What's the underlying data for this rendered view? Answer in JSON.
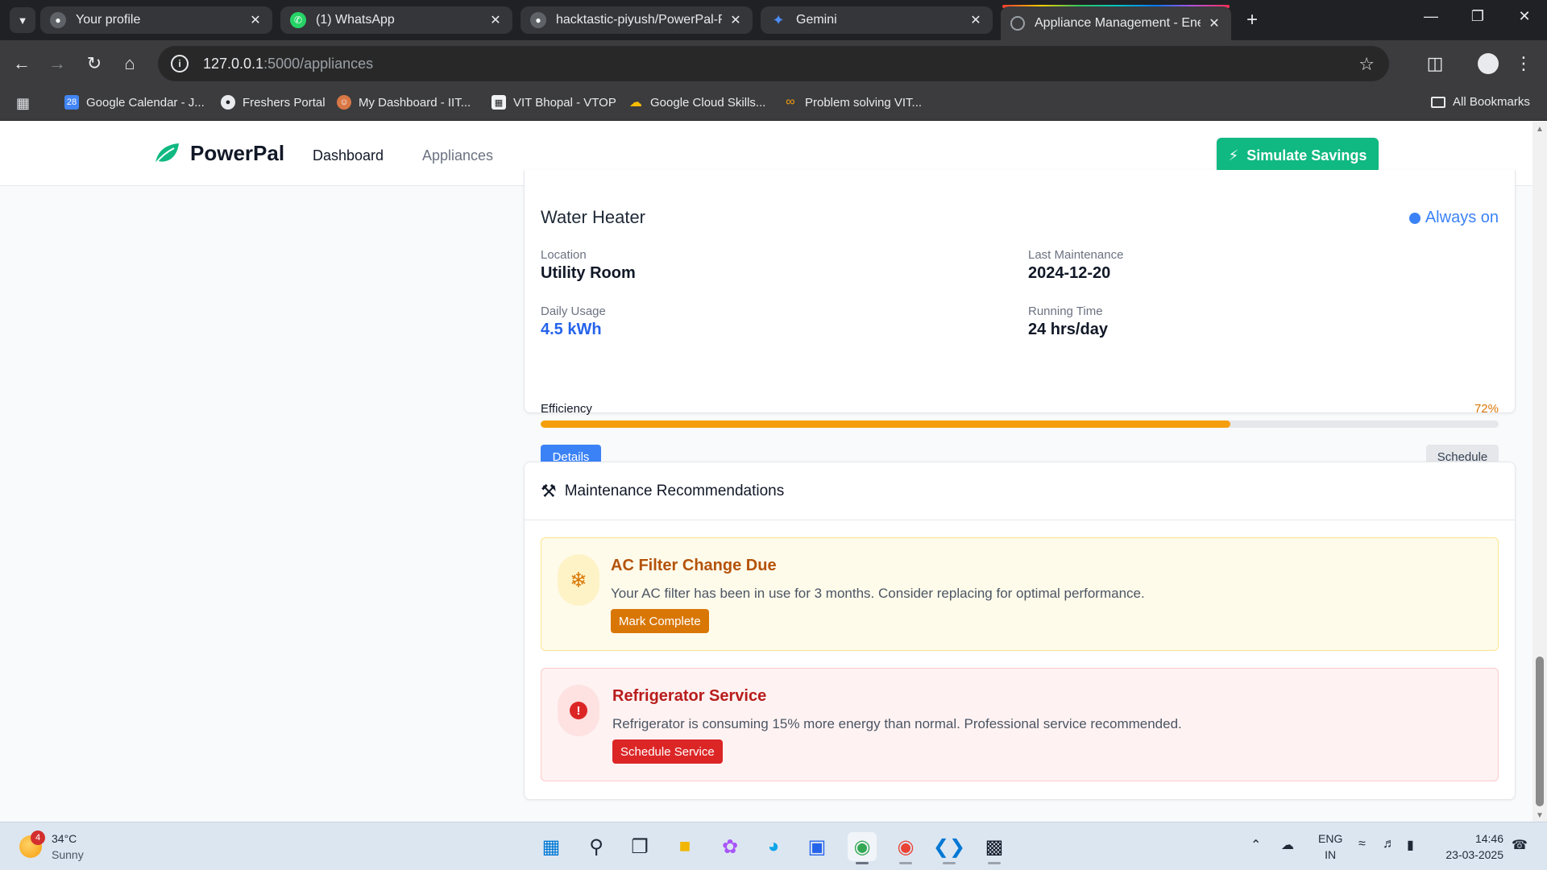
{
  "browser": {
    "tabs": [
      {
        "title": "Your profile",
        "icon": "github-icon"
      },
      {
        "title": "(1) WhatsApp",
        "icon": "whatsapp-icon"
      },
      {
        "title": "hacktastic-piyush/PowerPal-Pro",
        "icon": "github-icon"
      },
      {
        "title": "Gemini",
        "icon": "gemini-icon"
      },
      {
        "title": "Appliance Management - Energ",
        "icon": "globe-icon"
      }
    ],
    "url_host": "127.0.0.1",
    "url_path": ":5000/appliances",
    "bookmarks": [
      "Google Calendar - J...",
      "Freshers Portal",
      "My Dashboard - IIT...",
      "VIT Bhopal - VTOP",
      "Google Cloud Skills...",
      "Problem solving VIT..."
    ],
    "all_bookmarks": "All Bookmarks"
  },
  "app": {
    "brand": "PowerPal",
    "nav": {
      "dashboard": "Dashboard",
      "appliances": "Appliances"
    },
    "simulate_button": "Simulate Savings",
    "accent_color": "#10b981"
  },
  "appliance": {
    "name": "Water Heater",
    "status": "Always on",
    "location_label": "Location",
    "location": "Utility Room",
    "maintenance_label": "Last Maintenance",
    "maintenance": "2024-12-20",
    "usage_label": "Daily Usage",
    "usage": "4.5 kWh",
    "runtime_label": "Running Time",
    "runtime": "24 hrs/day",
    "efficiency_label": "Efficiency",
    "efficiency_pct": "72%",
    "efficiency_value": 72,
    "details_button": "Details",
    "schedule_button": "Schedule"
  },
  "maintenance": {
    "title": "Maintenance Recommendations",
    "items": [
      {
        "title": "AC Filter Change Due",
        "text": "Your AC filter has been in use for 3 months. Consider replacing for optimal performance.",
        "button": "Mark Complete",
        "icon": "snowflake-icon",
        "color": "#d97706"
      },
      {
        "title": "Refrigerator Service",
        "text": "Refrigerator is consuming 15% more energy than normal. Professional service recommended.",
        "button": "Schedule Service",
        "icon": "alert-icon",
        "color": "#dc2626"
      }
    ]
  },
  "taskbar": {
    "weather_badge": "4",
    "temperature": "34°C",
    "condition": "Sunny",
    "lang_top": "ENG",
    "lang_bottom": "IN",
    "time": "14:46",
    "date": "23-03-2025"
  }
}
